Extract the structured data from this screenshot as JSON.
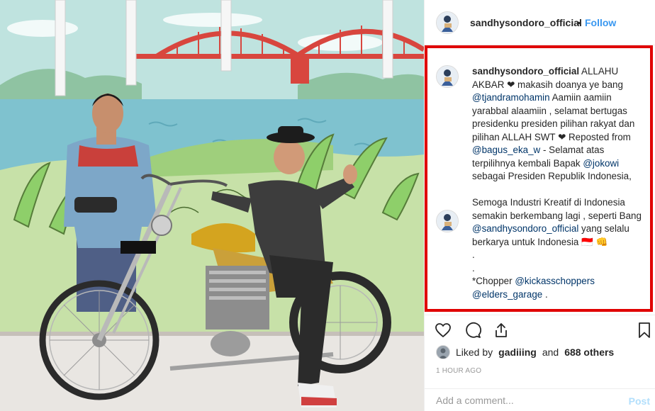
{
  "post": {
    "username": "sandhysondoro_official",
    "separator": "•",
    "follow_label": "Follow"
  },
  "caption": {
    "author": "sandhysondoro_official",
    "segments": [
      {
        "type": "text",
        "text": " ALLAHU AKBAR ❤ makasih doanya ye bang "
      },
      {
        "type": "link",
        "text": "@tjandramohamin"
      },
      {
        "type": "text",
        "text": " Aamiin aamiin yarabbal alaamiin , selamat bertugas presidenku presiden pilihan rakyat dan pilihan ALLAH SWT ❤ Reposted from "
      },
      {
        "type": "link",
        "text": "@bagus_eka_w"
      },
      {
        "type": "text",
        "text": " - Selamat atas terpilihnya kembali Bapak "
      },
      {
        "type": "link",
        "text": "@jokowi"
      },
      {
        "type": "text",
        "text": " sebagai Presiden Republik Indonesia,\n\nSemoga Industri Kreatif di Indonesia semakin berkembang lagi , seperti Bang "
      },
      {
        "type": "link",
        "text": "@sandhysondoro_official"
      },
      {
        "type": "text",
        "text": " yang selalu berkarya untuk Indonesia 🇮🇩 👊\n.\n.\n*Chopper "
      },
      {
        "type": "link",
        "text": "@kickasschoppers"
      },
      {
        "type": "text",
        "text": "\n"
      },
      {
        "type": "link",
        "text": "@elders_garage"
      },
      {
        "type": "text",
        "text": " ."
      }
    ]
  },
  "actions": {
    "like_icon": "heart-icon",
    "comment_icon": "comment-icon",
    "share_icon": "share-icon",
    "save_icon": "bookmark-icon"
  },
  "likes": {
    "prefix": "Liked by",
    "user": "gadiiing",
    "joiner": "and",
    "others": "688 others"
  },
  "timestamp": "1 HOUR AGO",
  "comment": {
    "placeholder": "Add a comment...",
    "post_label": "Post"
  },
  "colors": {
    "accent": "#3897f0",
    "highlight": "#e00000",
    "link": "#003569",
    "post_disabled": "#b2dffc"
  }
}
